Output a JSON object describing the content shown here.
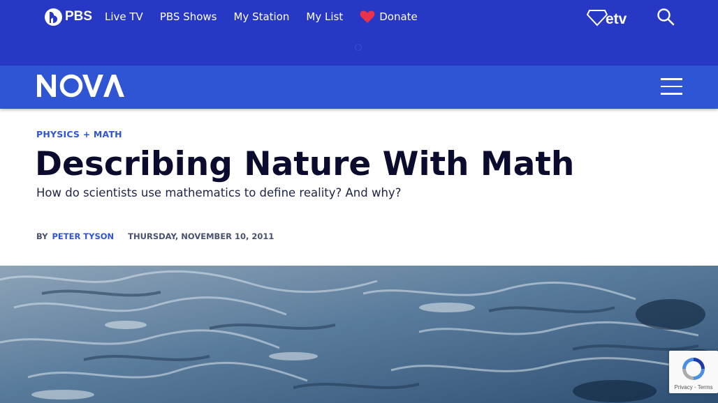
{
  "pbs_header": {
    "logo_text": "PBS",
    "nav": [
      "Live TV",
      "PBS Shows",
      "My Station",
      "My List"
    ],
    "donate_label": "Donate",
    "station_logo_text": "etv",
    "colors": {
      "bar": "#2638c4",
      "donate_heart": "#e8334a"
    }
  },
  "nova_header": {
    "logo_text": "NOVA",
    "color": "#2f55d4"
  },
  "article": {
    "category": "PHYSICS + MATH",
    "title": "Describing Nature With Math",
    "dek": "How do scientists use mathematics to define reality? And why?",
    "byline_prefix": "BY",
    "author": "PETER TYSON",
    "date": "THURSDAY, NOVEMBER 10, 2011"
  },
  "recaptcha": {
    "links": "Privacy - Terms"
  }
}
